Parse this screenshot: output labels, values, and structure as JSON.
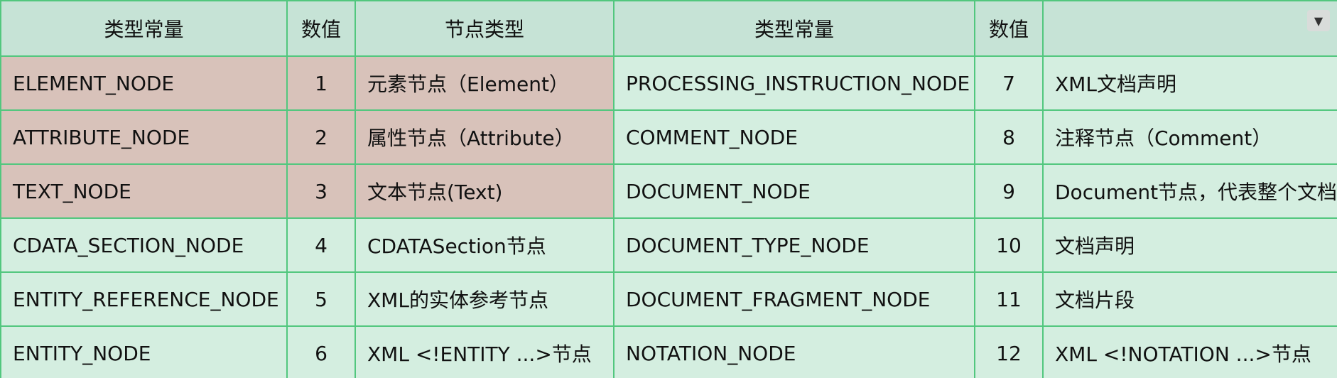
{
  "header": {
    "col1": "类型常量",
    "col2": "数值",
    "col3": "节点类型",
    "col4": "类型常量",
    "col5": "数值",
    "col6": "",
    "dropdown_icon": "▼"
  },
  "rows": [
    {
      "c1": "ELEMENT_NODE",
      "c2": "1",
      "c3": "元素节点（Element）",
      "c4": "PROCESSING_INSTRUCTION_NODE",
      "c5": "7",
      "c6": "XML文档声明"
    },
    {
      "c1": "ATTRIBUTE_NODE",
      "c2": "2",
      "c3": "属性节点（Attribute）",
      "c4": "COMMENT_NODE",
      "c5": "8",
      "c6": "注释节点（Comment）"
    },
    {
      "c1": "TEXT_NODE",
      "c2": "3",
      "c3": "文本节点(Text)",
      "c4": "DOCUMENT_NODE",
      "c5": "9",
      "c6": "Document节点，代表整个文档"
    },
    {
      "c1": "CDATA_SECTION_NODE",
      "c2": "4",
      "c3": "CDATASection节点",
      "c4": "DOCUMENT_TYPE_NODE",
      "c5": "10",
      "c6": "文档声明"
    },
    {
      "c1": "ENTITY_REFERENCE_NODE",
      "c2": "5",
      "c3": "XML的实体参考节点",
      "c4": "DOCUMENT_FRAGMENT_NODE",
      "c5": "11",
      "c6": "文档片段"
    },
    {
      "c1": "ENTITY_NODE",
      "c2": "6",
      "c3": "XML <!ENTITY ...>节点",
      "c4": "NOTATION_NODE",
      "c5": "12",
      "c6": "XML <!NOTATION ...>节点"
    }
  ],
  "colors": {
    "border": "#52c77e",
    "header_bg": "#c6e3d6",
    "cell_bg": "#d4eee0",
    "highlight_bg": "#d8c2ba"
  }
}
